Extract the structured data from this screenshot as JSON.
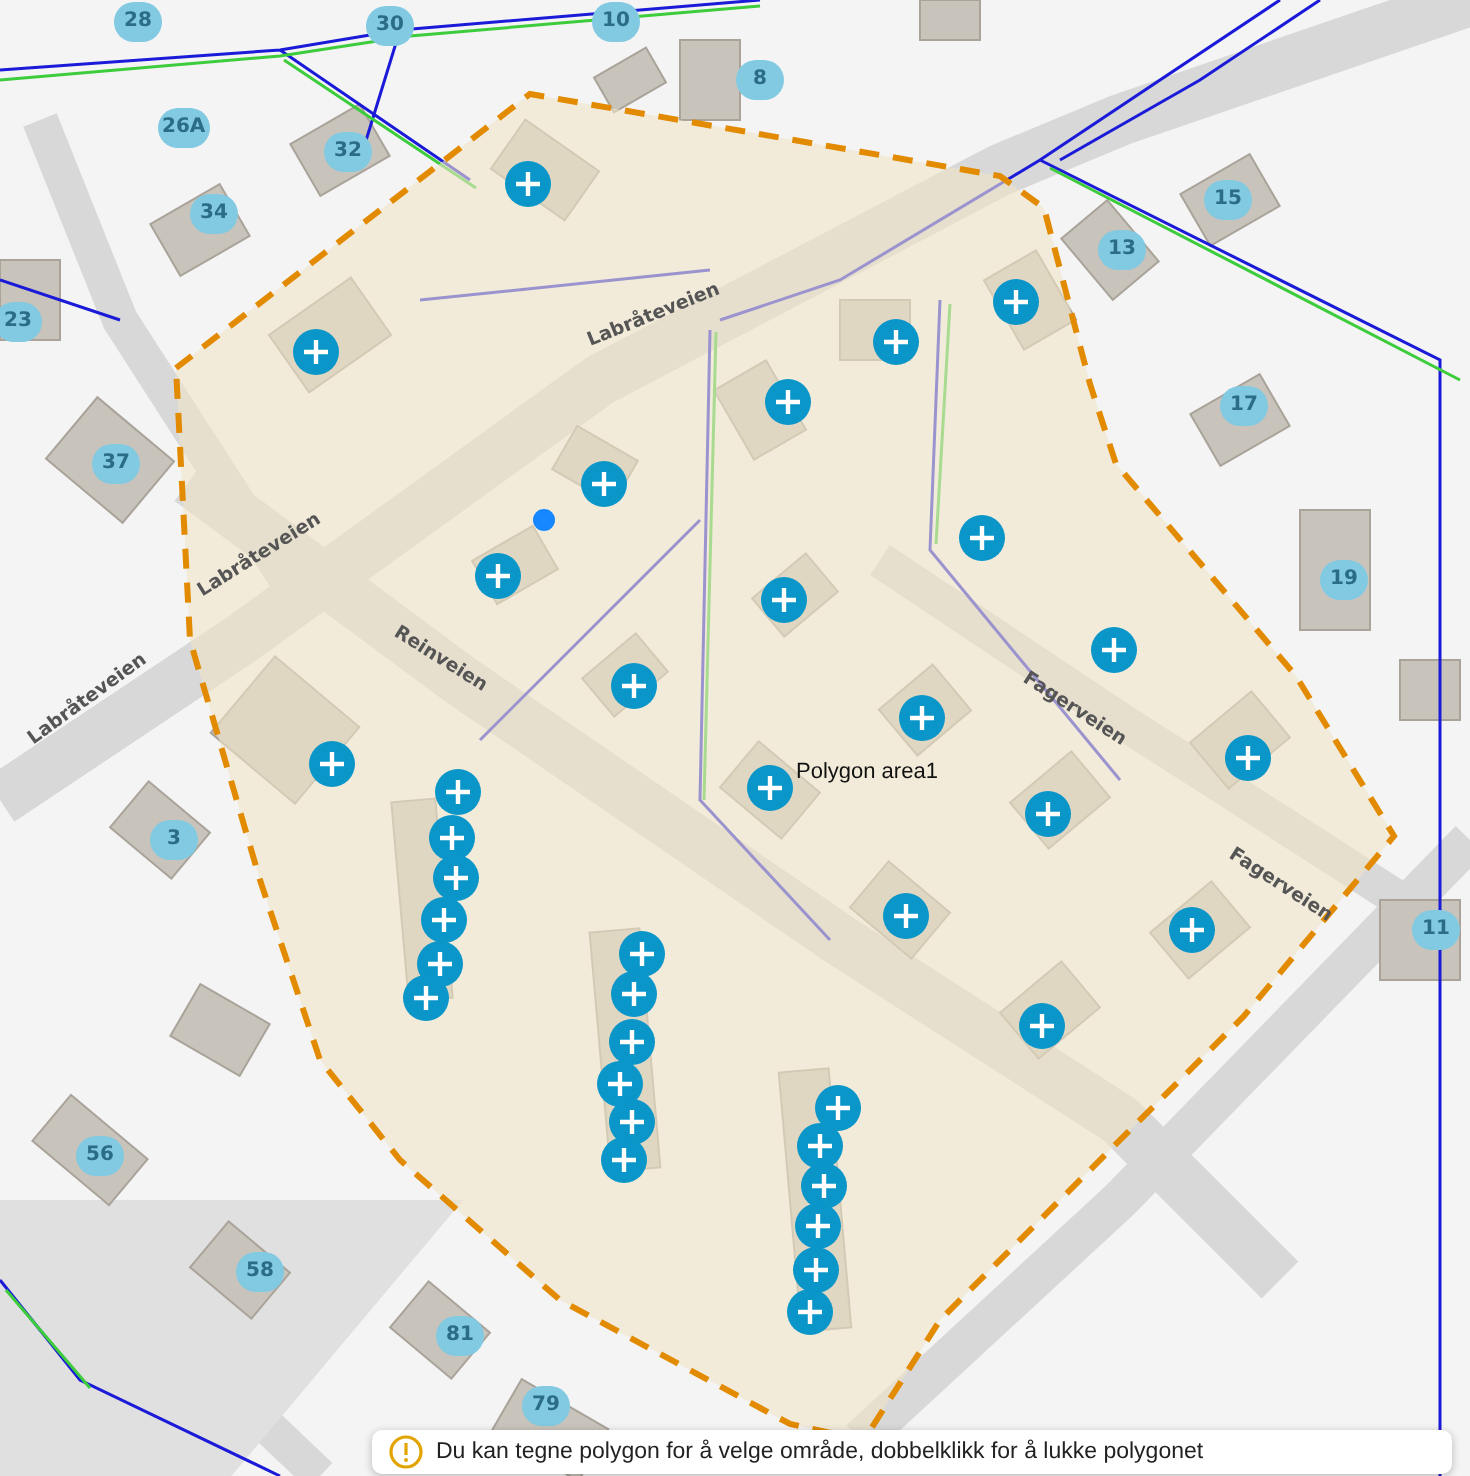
{
  "map": {
    "house_numbers": [
      "28",
      "30",
      "10",
      "8",
      "26A",
      "32",
      "34",
      "23",
      "37",
      "13",
      "15",
      "17",
      "19",
      "11",
      "3",
      "56",
      "58",
      "81",
      "79"
    ],
    "street_labels": [
      "Labråteveien",
      "Labråteveien",
      "Labråteveien",
      "Reinveien",
      "Fagerveien",
      "Fagerveien"
    ],
    "polygon_label": "Polygon area1"
  },
  "hint": {
    "text": "Du kan tegne polygon for å velge område, dobbelklikk for å lukke polygonet"
  }
}
